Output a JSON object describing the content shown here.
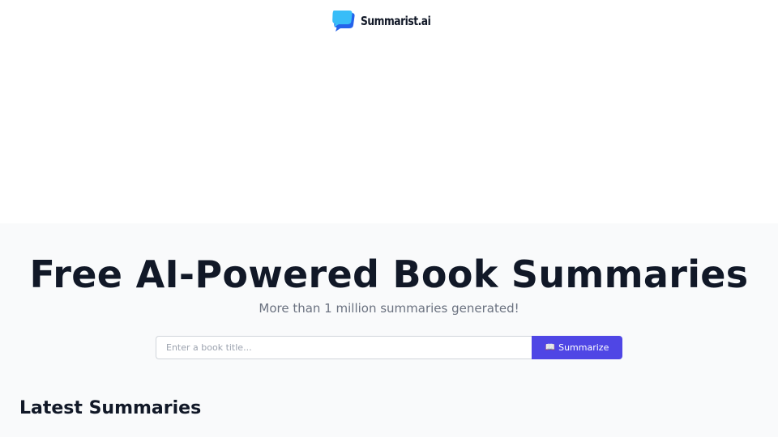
{
  "header": {
    "brand_name": "Summarist.ai",
    "logo_icon": "chat-bubble-logo-icon"
  },
  "hero": {
    "title": "Free AI-Powered Book Summaries",
    "subtitle": "More than 1 million summaries generated!"
  },
  "search": {
    "placeholder": "Enter a book title...",
    "value": "",
    "button_icon": "📖",
    "button_label": "Summarize"
  },
  "latest": {
    "title": "Latest Summaries"
  },
  "colors": {
    "accent": "#4f46e5",
    "logo_light": "#38bdf8",
    "logo_dark": "#2563eb",
    "hero_background": "#f9fafb",
    "heading_text": "#111827",
    "muted_text": "#6b7280"
  }
}
